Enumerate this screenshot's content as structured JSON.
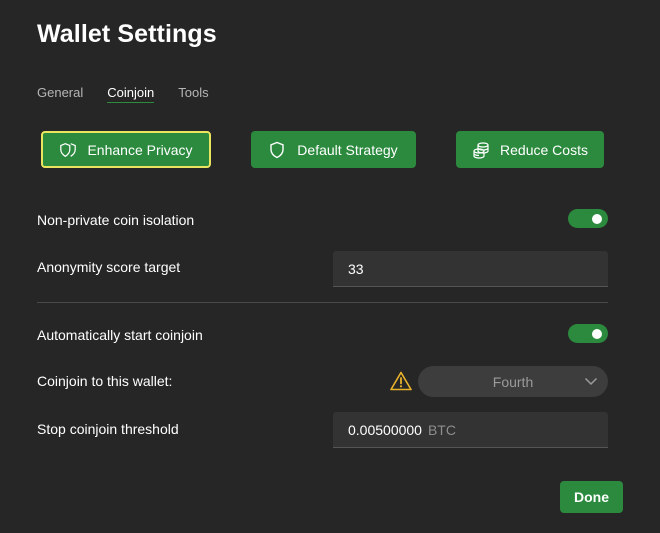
{
  "title": "Wallet Settings",
  "tabs": [
    {
      "label": "General",
      "active": false
    },
    {
      "label": "Coinjoin",
      "active": true
    },
    {
      "label": "Tools",
      "active": false
    }
  ],
  "strategies": [
    {
      "label": "Enhance Privacy",
      "icon": "double-shield-icon",
      "selected": true
    },
    {
      "label": "Default Strategy",
      "icon": "shield-icon",
      "selected": false
    },
    {
      "label": "Reduce Costs",
      "icon": "coins-icon",
      "selected": false
    }
  ],
  "settings": {
    "isolation_label": "Non-private coin isolation",
    "isolation_on": true,
    "anon_label": "Anonymity score target",
    "anon_value": "33",
    "auto_start_label": "Automatically start coinjoin",
    "auto_start_on": true,
    "target_wallet_label": "Coinjoin to this wallet:",
    "target_wallet_value": "Fourth",
    "threshold_label": "Stop coinjoin threshold",
    "threshold_value": "0.00500000",
    "threshold_unit": "BTC"
  },
  "done_label": "Done",
  "colors": {
    "background": "#262626",
    "accent": "#2b8a3e",
    "selected_outline": "#e9e55e",
    "warning": "#e8b22b"
  }
}
